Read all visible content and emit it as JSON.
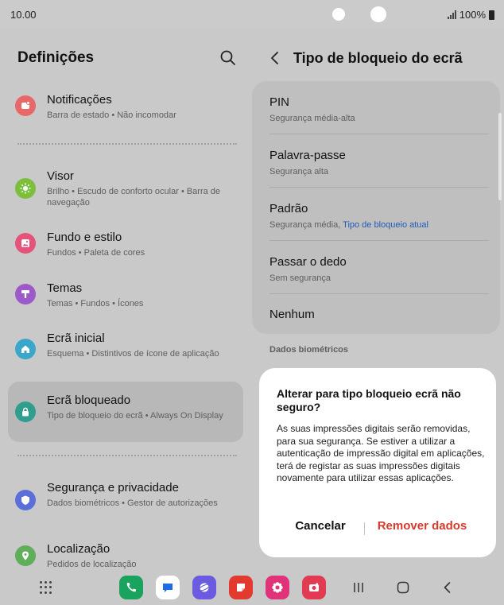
{
  "status_bar": {
    "time": "10.00",
    "battery": "100%"
  },
  "settings": {
    "title": "Definições",
    "items": [
      {
        "label": "Notificações",
        "sub": "Barra de estado  •  Não incomodar",
        "icon": "bell-icon",
        "color": "#e8686a"
      },
      {
        "label": "Visor",
        "sub": "Brilho  •  Escudo de conforto ocular  •  Barra de navegação",
        "icon": "sun-icon",
        "color": "#7cbf3b"
      },
      {
        "label": "Fundo e estilo",
        "sub": "Fundos  •  Paleta de cores",
        "icon": "image-icon",
        "color": "#e5527a"
      },
      {
        "label": "Temas",
        "sub": "Temas  •  Fundos  •  Ícones",
        "icon": "brush-icon",
        "color": "#9b59c9"
      },
      {
        "label": "Ecrã inicial",
        "sub": "Esquema  •  Distintivos de ícone de aplicação",
        "icon": "home-icon",
        "color": "#3aa6c9"
      },
      {
        "label": "Ecrã bloqueado",
        "sub": "Tipo de bloqueio do ecrã  •  Always On Display",
        "icon": "lock-icon",
        "color": "#2f9e8f"
      },
      {
        "label": "Segurança e privacidade",
        "sub": "Dados biométricos  •  Gestor de autorizações",
        "icon": "shield-icon",
        "color": "#5b6fd8"
      },
      {
        "label": "Localização",
        "sub": "Pedidos de localização",
        "icon": "location-icon",
        "color": "#5fae5a"
      }
    ]
  },
  "lock_screen": {
    "title": "Tipo de bloqueio do ecrã",
    "options": [
      {
        "label": "PIN",
        "sub": "Segurança média-alta"
      },
      {
        "label": "Palavra-passe",
        "sub": "Segurança alta"
      },
      {
        "label": "Padrão",
        "sub": "Segurança média, ",
        "sub_accent": "Tipo de bloqueio atual"
      },
      {
        "label": "Passar o dedo",
        "sub": "Sem segurança"
      },
      {
        "label": "Nenhum",
        "sub": ""
      }
    ],
    "section_label": "Dados biométricos"
  },
  "dialog": {
    "title": "Alterar para tipo bloqueio ecrã não seguro?",
    "body": "As suas impressões digitais serão removidas, para sua segurança. Se estiver a utilizar a autenticação de impressão digital em aplicações, terá de registar as suas impressões digitais novamente para utilizar essas aplicações.",
    "cancel": "Cancelar",
    "confirm": "Remover dados"
  },
  "taskbar": {
    "apps": [
      {
        "name": "phone-app",
        "color": "#1aa35c"
      },
      {
        "name": "messages-app",
        "color": "#ffffff"
      },
      {
        "name": "internet-app",
        "color": "#6a5be0"
      },
      {
        "name": "notes-app",
        "color": "#e23a2e"
      },
      {
        "name": "gallery-app",
        "color": "#e0337a"
      },
      {
        "name": "camera-app",
        "color": "#e23a52"
      }
    ]
  }
}
